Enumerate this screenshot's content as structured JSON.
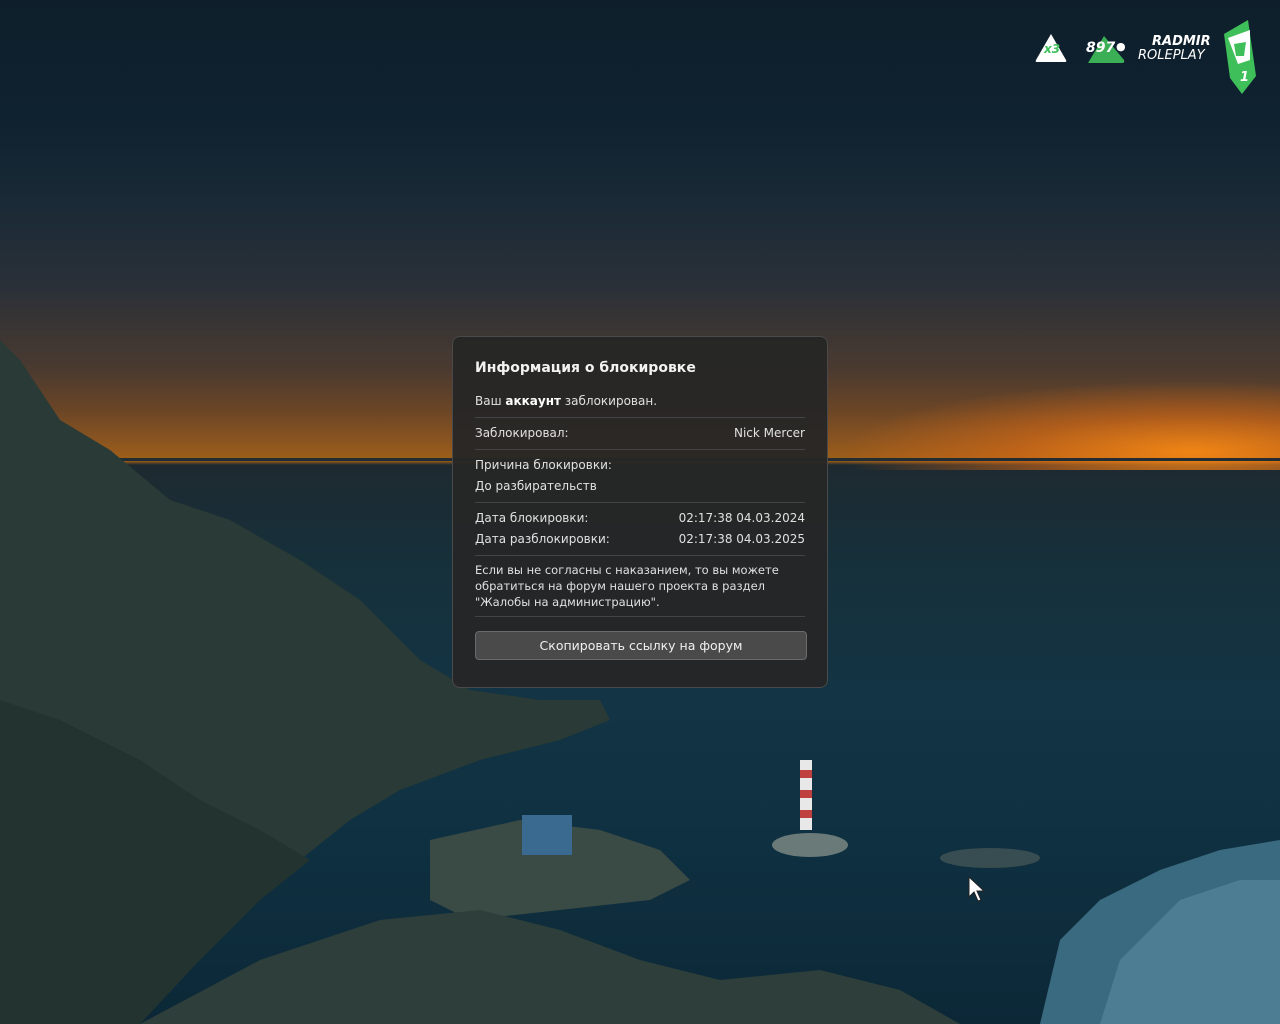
{
  "hud": {
    "multiplier": "x3",
    "online_count": "897",
    "logo_line1": "RADMIR",
    "logo_line2": "ROLEPLAY",
    "server_number": "1",
    "accent_color": "#3fbf5a"
  },
  "dialog": {
    "title": "Информация о блокировке",
    "status_prefix": "Ваш ",
    "status_bold": "аккаунт",
    "status_suffix": " заблокирован.",
    "blocked_by_label": "Заблокировал:",
    "blocked_by_value": "Nick Mercer",
    "reason_label": "Причина блокировки:",
    "reason_value": "До разбирательств",
    "ban_date_label": "Дата блокировки:",
    "ban_date_value": "02:17:38 04.03.2024",
    "unban_date_label": "Дата разблокировки:",
    "unban_date_value": "02:17:38 04.03.2025",
    "notice_text": "Если вы не согласны с наказанием, то вы можете обратиться на форум нашего проекта в раздел \"Жалобы на администрацию\".",
    "copy_button_label": "Скопировать ссылку на форум"
  }
}
